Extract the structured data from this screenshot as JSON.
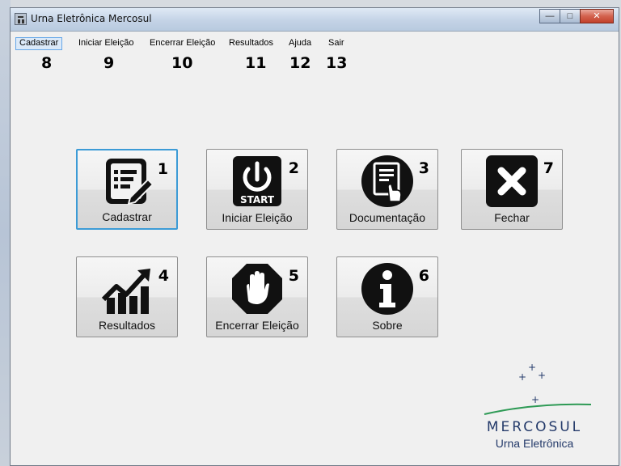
{
  "window": {
    "title": "Urna Eletrônica Mercosul",
    "controls": {
      "minimize": "—",
      "maximize": "□",
      "close": "✕"
    }
  },
  "menu": {
    "items": [
      {
        "label": "Cadastrar",
        "callout": "8",
        "active": true
      },
      {
        "label": "Iniciar Eleição",
        "callout": "9"
      },
      {
        "label": "Encerrar Eleição",
        "callout": "10"
      },
      {
        "label": "Resultados",
        "callout": "11"
      },
      {
        "label": "Ajuda",
        "callout": "12"
      },
      {
        "label": "Sair",
        "callout": "13"
      }
    ]
  },
  "tiles": [
    {
      "label": "Cadastrar",
      "number": "1",
      "icon": "register-form-edit-icon",
      "focused": true
    },
    {
      "label": "Iniciar Eleição",
      "number": "2",
      "icon": "power-start-icon",
      "badge": "START"
    },
    {
      "label": "Documentação",
      "number": "3",
      "icon": "document-touch-icon"
    },
    {
      "label": "Fechar",
      "number": "7",
      "icon": "close-x-icon"
    },
    {
      "label": "Resultados",
      "number": "4",
      "icon": "rising-chart-icon"
    },
    {
      "label": "Encerrar Eleição",
      "number": "5",
      "icon": "stop-hand-icon"
    },
    {
      "label": "Sobre",
      "number": "6",
      "icon": "info-icon"
    }
  ],
  "logo": {
    "word": "MERCOSUL",
    "sub": "Urna Eletrônica",
    "color": "#243a6a",
    "arc_color": "#2e9a55"
  },
  "colors": {
    "focus_border": "#3c9bd6",
    "menu_active_bg": "#dbe9f8",
    "menu_active_border": "#66a7e8",
    "icon_dark": "#111111"
  }
}
